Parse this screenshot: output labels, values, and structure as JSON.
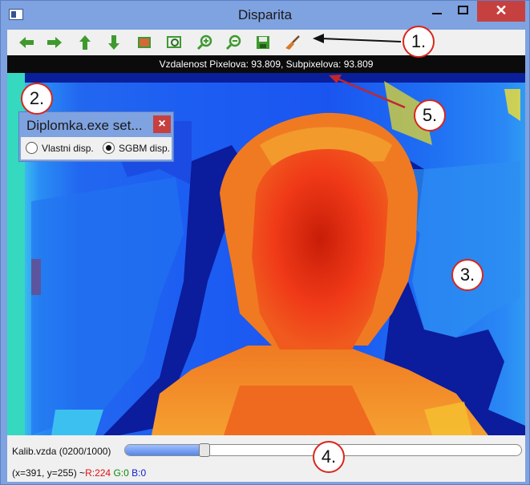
{
  "window": {
    "title": "Disparita"
  },
  "toolbar": {
    "buttons": [
      {
        "name": "arrow-left-icon"
      },
      {
        "name": "arrow-right-icon"
      },
      {
        "name": "arrow-up-icon"
      },
      {
        "name": "arrow-down-icon"
      },
      {
        "name": "picture-icon"
      },
      {
        "name": "zoom-fit-icon"
      },
      {
        "name": "zoom-in-icon"
      },
      {
        "name": "zoom-out-icon"
      },
      {
        "name": "save-icon"
      },
      {
        "name": "brush-icon"
      }
    ]
  },
  "status_top": "Vzdalenost Pixelova: 93.809, Subpixelova: 93.809",
  "settings": {
    "title": "Diplomka.exe set...",
    "close": "×",
    "options": [
      {
        "label": "Vlastni disp.",
        "selected": false
      },
      {
        "label": "SGBM disp.",
        "selected": true
      }
    ]
  },
  "slider": {
    "label": "Kalib.vzda (0200/1000)",
    "value": 200,
    "max": 1000
  },
  "pixel_status": {
    "coords": "(x=391, y=255) ~",
    "r": "R:224",
    "g": "G:0",
    "b": "B:0"
  },
  "callouts": [
    "1.",
    "2.",
    "3.",
    "4.",
    "5."
  ],
  "colors": {
    "titlebar": "#7fa2e0",
    "close": "#c74040",
    "callout_border": "#d9261c",
    "arrow": "#c0272d"
  }
}
